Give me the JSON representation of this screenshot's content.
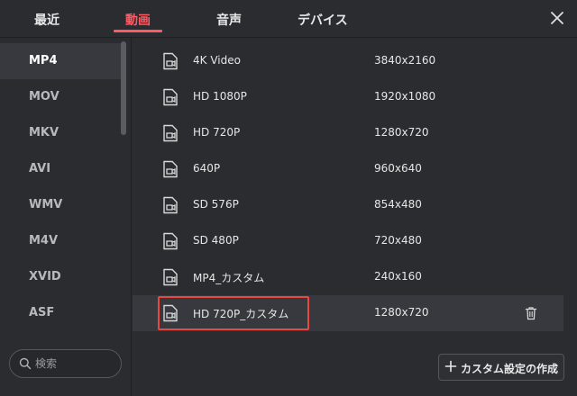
{
  "tabs": [
    {
      "label": "最近",
      "active": false
    },
    {
      "label": "動画",
      "active": true
    },
    {
      "label": "音声",
      "active": false
    },
    {
      "label": "デバイス",
      "active": false
    }
  ],
  "formats": [
    "MP4",
    "MOV",
    "MKV",
    "AVI",
    "WMV",
    "M4V",
    "XVID",
    "ASF"
  ],
  "selected_format": "MP4",
  "search": {
    "placeholder": "検索"
  },
  "presets": [
    {
      "name": "4K Video",
      "resolution": "3840x2160"
    },
    {
      "name": "HD 1080P",
      "resolution": "1920x1080"
    },
    {
      "name": "HD 720P",
      "resolution": "1280x720"
    },
    {
      "name": "640P",
      "resolution": "960x640"
    },
    {
      "name": "SD 576P",
      "resolution": "854x480"
    },
    {
      "name": "SD 480P",
      "resolution": "720x480"
    },
    {
      "name": "MP4_カスタム",
      "resolution": "240x160"
    },
    {
      "name": "HD 720P_カスタム",
      "resolution": "1280x720"
    }
  ],
  "selected_preset": "HD 720P_カスタム",
  "create_button": {
    "label": "カスタム設定の作成"
  },
  "colors": {
    "accent": "#ff5a63",
    "highlight_border": "#e8483f",
    "background": "#2b2c30",
    "selected_row": "#38393e"
  }
}
